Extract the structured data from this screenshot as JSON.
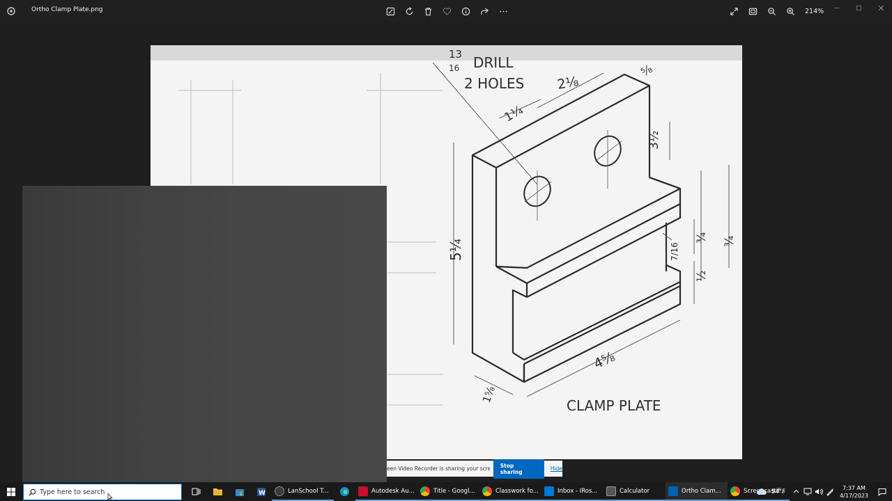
{
  "window": {
    "title": "Ortho Clamp Plate.png",
    "zoom": "214%",
    "toolbar_icons": [
      "edit-icon",
      "rotate-icon",
      "delete-icon",
      "favorite-icon",
      "info-icon",
      "share-icon",
      "more-icon"
    ],
    "right_icons": [
      "expand-icon",
      "fit-icon",
      "zoom-out-icon",
      "zoom-in-icon"
    ],
    "controls": [
      "minimize-icon",
      "maximize-icon",
      "close-icon"
    ]
  },
  "drawing": {
    "drill_num": "13",
    "drill_den": "16",
    "drill_label": "DRILL",
    "holes_label": "2 HOLES",
    "dim_2_1_8": "2⅛",
    "dim_1_1_4": "1¼",
    "dim_5_8_top": "⅝",
    "dim_3_1_2_left": "3½",
    "dim_5_1_4": "5¼",
    "dim_3_4_a": "¾",
    "dim_3_4_b": "¾",
    "dim_7_16": "7/16",
    "dim_1_2": "½",
    "dim_4_5_8": "4⅝",
    "dim_1_5_8": "1⅝",
    "caption": "CLAMP PLATE"
  },
  "share_bar": {
    "message": "een Video Recorder is sharing your screen.",
    "stop_label": "Stop sharing",
    "hide_label": "Hide"
  },
  "taskbar": {
    "search_placeholder": "Type here to search",
    "tasks": [
      {
        "label": "LanSchool T...",
        "color": "#3b3b3b"
      },
      {
        "label": "Autodesk Au...",
        "color": "#c8102e"
      },
      {
        "label": "Title - Googl...",
        "color": "#4285f4"
      },
      {
        "label": "Classwork fo...",
        "color": "#34a853"
      },
      {
        "label": "Inbox - IRos...",
        "color": "#0078d4"
      },
      {
        "label": "Calculator",
        "color": "#555555"
      },
      {
        "label": "Ortho Clam...",
        "color": "#0063b1"
      },
      {
        "label": "Screencastif...",
        "color": "#fbbc05"
      }
    ],
    "weather": "54°F",
    "time": "7:37 AM",
    "date": "4/17/2023"
  }
}
